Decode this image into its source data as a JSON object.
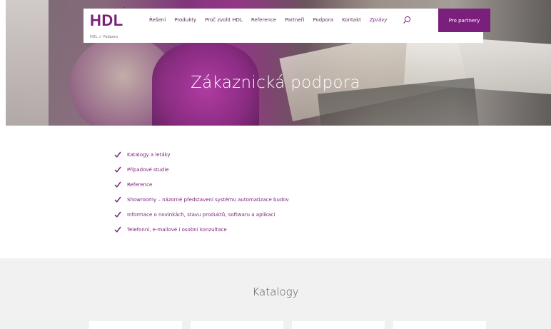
{
  "header": {
    "logo": "HDL",
    "logo_mark": "°",
    "nav": [
      "Řešení",
      "Produkty",
      "Proč zvolit HDL",
      "Reference",
      "Partneři",
      "Podpora",
      "Kontakt"
    ],
    "nav_highlight": "Zprávy",
    "partner_button": "Pro partnery",
    "accent_color": "#7b1f7d"
  },
  "breadcrumb": {
    "root": "HDL",
    "separator": ">",
    "current": "Podpora"
  },
  "hero": {
    "title": "Zákaznická podpora"
  },
  "checklist": {
    "items": [
      "Katalogy a letáky",
      "Případové studie",
      "Reference",
      "Showroomy – názorné představení systému automatizace budov",
      "Informace o novinkách, stavu produktů, softwaru a aplikací",
      "Telefonní, e-mailové i osobní konzultace"
    ],
    "icon": "check-icon"
  },
  "catalogs": {
    "title": "Katalogy"
  }
}
